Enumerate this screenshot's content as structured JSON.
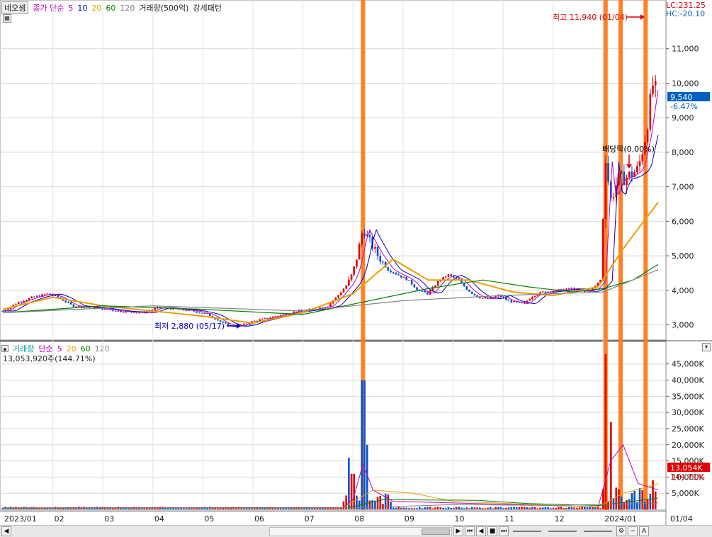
{
  "header": {
    "stock_name": "네오셈",
    "price_ma_label": "종가 단순",
    "ma_periods": [
      "5",
      "10",
      "20",
      "60",
      "120"
    ],
    "ma_colors": [
      "#c000c0",
      "#0000c0",
      "#e8a000",
      "#008000",
      "#808080"
    ],
    "volume_avg_label": "거래량(500억)",
    "pattern_label": "강세패턴"
  },
  "top_right": {
    "lc": "LC:231.25",
    "hc": "HC:-20.10"
  },
  "price_panel": {
    "high_note": "최고 11,940 (01/04)",
    "low_note": "최저 2,880 (05/17)",
    "dividend_note": "배당락(0.00%)",
    "current_price": "9,540",
    "current_change": "-6.47%",
    "y_ticks": [
      "3,000",
      "4,000",
      "5,000",
      "6,000",
      "7,000",
      "8,000",
      "9,000",
      "10,000",
      "11,000"
    ]
  },
  "volume_panel": {
    "label": "거래량",
    "ma_label": "단순",
    "ma_periods": [
      "5",
      "20",
      "60",
      "120"
    ],
    "ma_colors": [
      "#c000c0",
      "#e8a000",
      "#008000",
      "#808080"
    ],
    "current_volume_text": "13,053,920주(144.71%)",
    "current_volume_badge": "13,054K",
    "current_volume_pct": "144.71%",
    "y_ticks": [
      "5,000K",
      "10,000K",
      "15,000K",
      "20,000K",
      "25,000K",
      "30,000K",
      "35,000K",
      "40,000K",
      "45,000K"
    ]
  },
  "x_axis": {
    "labels": [
      "2023/01",
      "02",
      "03",
      "04",
      "05",
      "06",
      "07",
      "08",
      "09",
      "10",
      "11",
      "12",
      "2024/01",
      "01/04"
    ]
  },
  "controls": {
    "zoom_minus": "−",
    "zoom_a": "A"
  },
  "chart_data": {
    "type": "candlestick",
    "x_unit": "month index (Jan 2023 = 0)",
    "price_ylim": [
      2600,
      12000
    ],
    "volume_ylim": [
      0,
      48000
    ],
    "volume_unit": "K shares",
    "price_series_approx": [
      [
        0,
        3400
      ],
      [
        0.3,
        3650
      ],
      [
        0.6,
        3800
      ],
      [
        0.9,
        3900
      ],
      [
        1.1,
        3800
      ],
      [
        1.4,
        3550
      ],
      [
        1.8,
        3500
      ],
      [
        2.3,
        3400
      ],
      [
        2.8,
        3350
      ],
      [
        3.1,
        3500
      ],
      [
        3.5,
        3450
      ],
      [
        3.8,
        3400
      ],
      [
        4.1,
        3300
      ],
      [
        4.4,
        3050
      ],
      [
        4.6,
        2950
      ],
      [
        4.8,
        3000
      ],
      [
        5.0,
        3100
      ],
      [
        5.3,
        3200
      ],
      [
        5.6,
        3300
      ],
      [
        5.9,
        3400
      ],
      [
        6.2,
        3450
      ],
      [
        6.5,
        3550
      ],
      [
        6.7,
        3850
      ],
      [
        6.9,
        4200
      ],
      [
        7.0,
        4500
      ],
      [
        7.1,
        5100
      ],
      [
        7.2,
        5800
      ],
      [
        7.3,
        5500
      ],
      [
        7.5,
        5000
      ],
      [
        7.7,
        4600
      ],
      [
        7.9,
        4450
      ],
      [
        8.1,
        4300
      ],
      [
        8.3,
        4000
      ],
      [
        8.5,
        3900
      ],
      [
        8.7,
        4250
      ],
      [
        8.9,
        4450
      ],
      [
        9.1,
        4300
      ],
      [
        9.3,
        4000
      ],
      [
        9.5,
        3800
      ],
      [
        9.7,
        3750
      ],
      [
        9.9,
        3850
      ],
      [
        10.1,
        3700
      ],
      [
        10.4,
        3600
      ],
      [
        10.6,
        3850
      ],
      [
        10.8,
        3950
      ],
      [
        11.1,
        4000
      ],
      [
        11.4,
        4050
      ],
      [
        11.6,
        3950
      ],
      [
        11.8,
        4050
      ],
      [
        11.95,
        4300
      ],
      [
        12.05,
        7900
      ],
      [
        12.15,
        6600
      ],
      [
        12.3,
        7200
      ],
      [
        12.5,
        7300
      ],
      [
        12.7,
        7500
      ],
      [
        12.85,
        8500
      ],
      [
        13.0,
        10000
      ],
      [
        13.1,
        9540
      ]
    ],
    "ma_series_approx": [
      {
        "period": 20,
        "points": [
          [
            0,
            3450
          ],
          [
            1,
            3800
          ],
          [
            2,
            3550
          ],
          [
            3,
            3400
          ],
          [
            4,
            3250
          ],
          [
            5,
            3050
          ],
          [
            6,
            3350
          ],
          [
            7,
            3900
          ],
          [
            7.8,
            4900
          ],
          [
            8.5,
            4300
          ],
          [
            9.3,
            4300
          ],
          [
            10.2,
            3950
          ],
          [
            11,
            3850
          ],
          [
            11.9,
            4100
          ],
          [
            12.4,
            5200
          ],
          [
            13.1,
            6550
          ]
        ]
      },
      {
        "period": 60,
        "points": [
          [
            0,
            3350
          ],
          [
            2,
            3550
          ],
          [
            4,
            3450
          ],
          [
            6,
            3300
          ],
          [
            7,
            3600
          ],
          [
            8.5,
            4050
          ],
          [
            9.6,
            4300
          ],
          [
            10.5,
            4100
          ],
          [
            11.4,
            3950
          ],
          [
            12,
            4050
          ],
          [
            12.6,
            4300
          ],
          [
            13.1,
            4750
          ]
        ]
      },
      {
        "period": 120,
        "points": [
          [
            0,
            3350
          ],
          [
            3,
            3550
          ],
          [
            6,
            3400
          ],
          [
            8,
            3700
          ],
          [
            10,
            3850
          ],
          [
            12,
            3950
          ],
          [
            13.1,
            4600
          ]
        ]
      }
    ],
    "volume_spikes_approx": [
      [
        6.9,
        16000
      ],
      [
        7.0,
        11000
      ],
      [
        7.2,
        40000
      ],
      [
        7.3,
        20000
      ],
      [
        12.05,
        48000
      ],
      [
        12.15,
        27000
      ],
      [
        13.0,
        9000
      ],
      [
        13.1,
        13054
      ]
    ],
    "highlight_columns_months": [
      7.2,
      12.05,
      12.35,
      12.85
    ],
    "high_point": {
      "x": 13.0,
      "y": 11940
    },
    "low_point": {
      "x": 4.5,
      "y": 2880
    }
  }
}
